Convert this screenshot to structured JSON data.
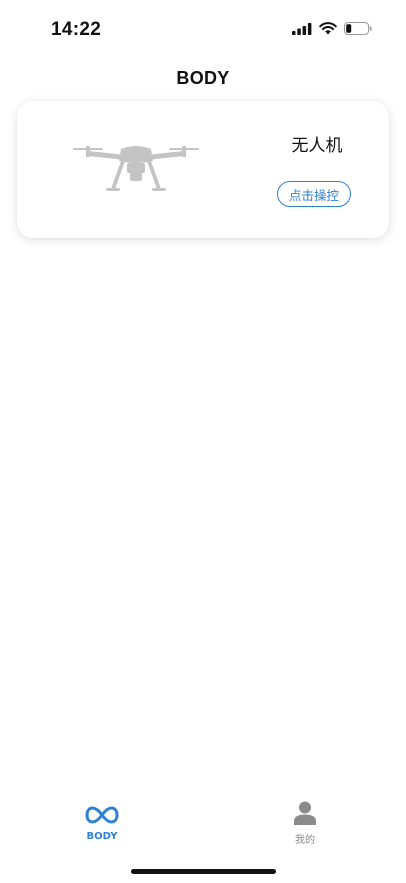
{
  "status_bar": {
    "time": "14:22",
    "battery_level": 0.2
  },
  "header": {
    "title": "BODY"
  },
  "device_card": {
    "image": "drone-image",
    "name": "无人机",
    "control_button": "点击操控"
  },
  "tab_bar": {
    "accent_color": "#2e82d3",
    "inactive_color": "#888888",
    "tabs": [
      {
        "label": "BODY",
        "icon": "infinity-icon",
        "active": true
      },
      {
        "label": "我的",
        "icon": "person-icon",
        "active": false
      }
    ]
  }
}
